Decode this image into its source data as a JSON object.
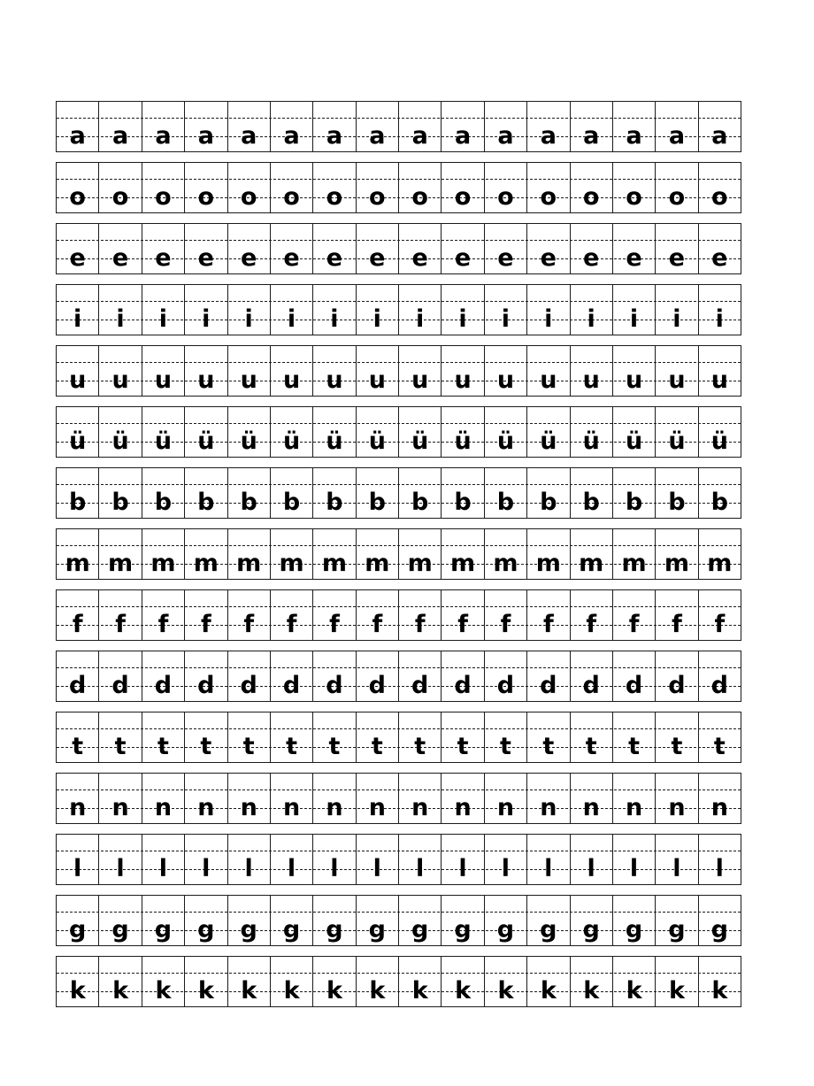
{
  "document": {
    "kind": "pinyin-handwriting-practice-worksheet",
    "page_background": "#ffffff",
    "line_color": "#1b1b1b",
    "letter_color": "#000000",
    "columns_per_row": 16,
    "rows_count": 15
  },
  "grid": {
    "rows": [
      {
        "letter": "a",
        "repetitions": 16
      },
      {
        "letter": "o",
        "repetitions": 16
      },
      {
        "letter": "e",
        "repetitions": 16
      },
      {
        "letter": "i",
        "repetitions": 16
      },
      {
        "letter": "u",
        "repetitions": 16
      },
      {
        "letter": "ü",
        "repetitions": 16
      },
      {
        "letter": "b",
        "repetitions": 16
      },
      {
        "letter": "m",
        "repetitions": 16
      },
      {
        "letter": "f",
        "repetitions": 16
      },
      {
        "letter": "d",
        "repetitions": 16
      },
      {
        "letter": "t",
        "repetitions": 16
      },
      {
        "letter": "n",
        "repetitions": 16
      },
      {
        "letter": "l",
        "repetitions": 16
      },
      {
        "letter": "g",
        "repetitions": 16
      },
      {
        "letter": "k",
        "repetitions": 16
      }
    ]
  }
}
